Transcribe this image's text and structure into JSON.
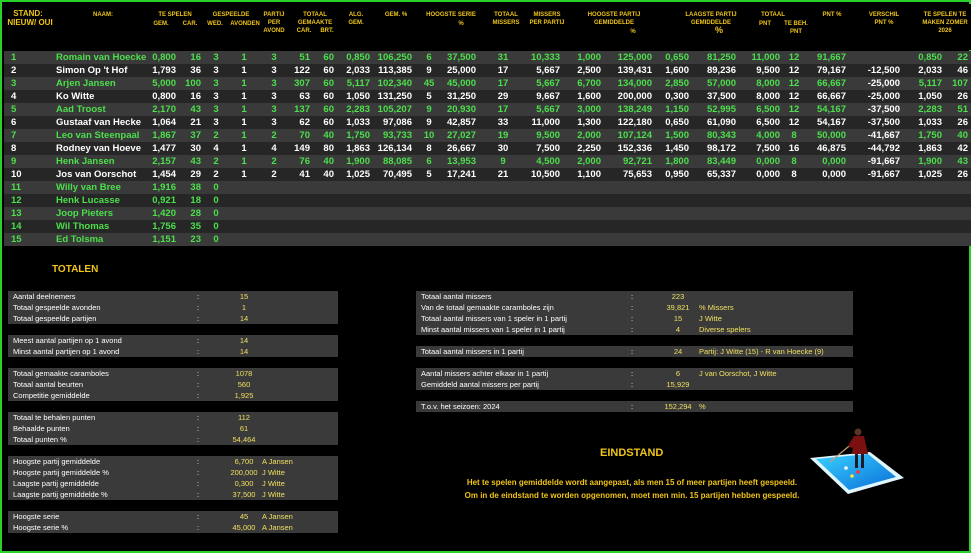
{
  "header": {
    "stand": "STAND:",
    "nieuw_oud": "NIEUW/ OUI",
    "naam": "NAAM:",
    "te_spelen": "TE SPELEN",
    "gem": "GEM.",
    "car": "CAR.",
    "gespeelde": "GESPEELDE",
    "wed": "WED.",
    "avonden": "AVONDEN",
    "partij_per_avond": "PARTIJ PER AVOND",
    "totaal_gemaakte": "TOTAAL GEMAAKTE",
    "car2": "CAR.",
    "brt": "BRT.",
    "alg_gem": "ALG. GEM.",
    "gem_pct": "GEM. %",
    "hoogste_serie": "HOOGSTE SERIE",
    "pct": "%",
    "totaal_missers": "TOTAAL MISSERS",
    "missers_per_partij": "MISSERS PER PARTIJ",
    "hoogste_partij_gem": "HOOGSTE PARTIJ GEMIDDELDE",
    "pct2": "%",
    "laagste_partij_gem": "LAAGSTE PARTIJ GEMIDDELDE",
    "pct3": "%",
    "totaal": "TOTAAL",
    "pnt": "PNT",
    "te_beh": "TE BEH. PNT",
    "pnt_pct": "PNT %",
    "verschil": "VERSCHIL PNT %",
    "te_spelen_zomer": "TE SPELEN TE MAKEN ZOMER 2026"
  },
  "players": [
    {
      "nr": "1",
      "naam": "Romain van Hoecke",
      "gem": "0,800",
      "car": "16",
      "wed": "3",
      "avo": "1",
      "ppa": "3",
      "tcar": "51",
      "brt": "60",
      "alg": "0,850",
      "gpct": "106,250",
      "hs": "6",
      "hspct": "37,500",
      "tm": "31",
      "mpp": "10,333",
      "hp": "1,000",
      "hppct": "125,000",
      "lp": "0,650",
      "lppct": "81,250",
      "tp": "11,000",
      "tb": "12",
      "pp": "91,667",
      "vp": "",
      "zg": "0,850",
      "zc": "22",
      "color": "#4cdf4c"
    },
    {
      "nr": "2",
      "naam": "Simon Op 't Hof",
      "gem": "1,793",
      "car": "36",
      "wed": "3",
      "avo": "1",
      "ppa": "3",
      "tcar": "122",
      "brt": "60",
      "alg": "2,033",
      "gpct": "113,385",
      "hs": "9",
      "hspct": "25,000",
      "tm": "17",
      "mpp": "5,667",
      "hp": "2,500",
      "hppct": "139,431",
      "lp": "1,600",
      "lppct": "89,236",
      "tp": "9,500",
      "tb": "12",
      "pp": "79,167",
      "vp": "-12,500",
      "zg": "2,033",
      "zc": "46",
      "color": "#ffffff"
    },
    {
      "nr": "3",
      "naam": "Arjen Jansen",
      "gem": "5,000",
      "car": "100",
      "wed": "3",
      "avo": "1",
      "ppa": "3",
      "tcar": "307",
      "brt": "60",
      "alg": "5,117",
      "gpct": "102,340",
      "hs": "45",
      "hspct": "45,000",
      "tm": "17",
      "mpp": "5,667",
      "hp": "6,700",
      "hppct": "134,000",
      "lp": "2,850",
      "lppct": "57,000",
      "tp": "8,000",
      "tb": "12",
      "pp": "66,667",
      "vp": "-25,000",
      "zg": "5,117",
      "zc": "107",
      "color": "#4cdf4c"
    },
    {
      "nr": "4",
      "naam": "Ko Witte",
      "gem": "0,800",
      "car": "16",
      "wed": "3",
      "avo": "1",
      "ppa": "3",
      "tcar": "63",
      "brt": "60",
      "alg": "1,050",
      "gpct": "131,250",
      "hs": "5",
      "hspct": "31,250",
      "tm": "29",
      "mpp": "9,667",
      "hp": "1,600",
      "hppct": "200,000",
      "lp": "0,300",
      "lppct": "37,500",
      "tp": "8,000",
      "tb": "12",
      "pp": "66,667",
      "vp": "-25,000",
      "zg": "1,050",
      "zc": "26",
      "color": "#ffffff"
    },
    {
      "nr": "5",
      "naam": "Aad Troost",
      "gem": "2,170",
      "car": "43",
      "wed": "3",
      "avo": "1",
      "ppa": "3",
      "tcar": "137",
      "brt": "60",
      "alg": "2,283",
      "gpct": "105,207",
      "hs": "9",
      "hspct": "20,930",
      "tm": "17",
      "mpp": "5,667",
      "hp": "3,000",
      "hppct": "138,249",
      "lp": "1,150",
      "lppct": "52,995",
      "tp": "6,500",
      "tb": "12",
      "pp": "54,167",
      "vp": "-37,500",
      "zg": "2,283",
      "zc": "51",
      "color": "#4cdf4c"
    },
    {
      "nr": "6",
      "naam": "Gustaaf van Hecke",
      "gem": "1,064",
      "car": "21",
      "wed": "3",
      "avo": "1",
      "ppa": "3",
      "tcar": "62",
      "brt": "60",
      "alg": "1,033",
      "gpct": "97,086",
      "hs": "9",
      "hspct": "42,857",
      "tm": "33",
      "mpp": "11,000",
      "hp": "1,300",
      "hppct": "122,180",
      "lp": "0,650",
      "lppct": "61,090",
      "tp": "6,500",
      "tb": "12",
      "pp": "54,167",
      "vp": "-37,500",
      "zg": "1,033",
      "zc": "26",
      "color": "#ffffff"
    },
    {
      "nr": "7",
      "naam": "Leo van Steenpaal",
      "gem": "1,867",
      "car": "37",
      "wed": "2",
      "avo": "1",
      "ppa": "2",
      "tcar": "70",
      "brt": "40",
      "alg": "1,750",
      "gpct": "93,733",
      "hs": "10",
      "hspct": "27,027",
      "tm": "19",
      "mpp": "9,500",
      "hp": "2,000",
      "hppct": "107,124",
      "lp": "1,500",
      "lppct": "80,343",
      "tp": "4,000",
      "tb": "8",
      "pp": "50,000",
      "vp": "-41,667",
      "zg": "1,750",
      "zc": "40",
      "color": "#4cdf4c"
    },
    {
      "nr": "8",
      "naam": "Rodney van Hoeve",
      "gem": "1,477",
      "car": "30",
      "wed": "4",
      "avo": "1",
      "ppa": "4",
      "tcar": "149",
      "brt": "80",
      "alg": "1,863",
      "gpct": "126,134",
      "hs": "8",
      "hspct": "26,667",
      "tm": "30",
      "mpp": "7,500",
      "hp": "2,250",
      "hppct": "152,336",
      "lp": "1,450",
      "lppct": "98,172",
      "tp": "7,500",
      "tb": "16",
      "pp": "46,875",
      "vp": "-44,792",
      "zg": "1,863",
      "zc": "42",
      "color": "#ffffff"
    },
    {
      "nr": "9",
      "naam": "Henk Jansen",
      "gem": "2,157",
      "car": "43",
      "wed": "2",
      "avo": "1",
      "ppa": "2",
      "tcar": "76",
      "brt": "40",
      "alg": "1,900",
      "gpct": "88,085",
      "hs": "6",
      "hspct": "13,953",
      "tm": "9",
      "mpp": "4,500",
      "hp": "2,000",
      "hppct": "92,721",
      "lp": "1,800",
      "lppct": "83,449",
      "tp": "0,000",
      "tb": "8",
      "pp": "0,000",
      "vp": "-91,667",
      "zg": "1,900",
      "zc": "43",
      "color": "#4cdf4c"
    },
    {
      "nr": "10",
      "naam": "Jos van Oorschot",
      "gem": "1,454",
      "car": "29",
      "wed": "2",
      "avo": "1",
      "ppa": "2",
      "tcar": "41",
      "brt": "40",
      "alg": "1,025",
      "gpct": "70,495",
      "hs": "5",
      "hspct": "17,241",
      "tm": "21",
      "mpp": "10,500",
      "hp": "1,100",
      "hppct": "75,653",
      "lp": "0,950",
      "lppct": "65,337",
      "tp": "0,000",
      "tb": "8",
      "pp": "0,000",
      "vp": "-91,667",
      "zg": "1,025",
      "zc": "26",
      "color": "#ffffff"
    },
    {
      "nr": "11",
      "naam": "Willy van Bree",
      "gem": "1,916",
      "car": "38",
      "wed": "0",
      "color": "#4cdf4c"
    },
    {
      "nr": "12",
      "naam": "Henk Lucasse",
      "gem": "0,921",
      "car": "18",
      "wed": "0",
      "color": "#4cdf4c"
    },
    {
      "nr": "13",
      "naam": "Joop Pieters",
      "gem": "1,420",
      "car": "28",
      "wed": "0",
      "color": "#4cdf4c"
    },
    {
      "nr": "14",
      "naam": "Wil Thomas",
      "gem": "1,756",
      "car": "35",
      "wed": "0",
      "color": "#4cdf4c"
    },
    {
      "nr": "15",
      "naam": "Ed Tolsma",
      "gem": "1,151",
      "car": "23",
      "wed": "0",
      "color": "#4cdf4c"
    }
  ],
  "totalen_title": "TOTALEN",
  "left_stats": [
    {
      "label": "Aantal deelnemers",
      "value": "15",
      "note": ""
    },
    {
      "label": "Totaal gespeelde avonden",
      "value": "1",
      "note": ""
    },
    {
      "label": "Totaal gespeelde partijen",
      "value": "14",
      "note": ""
    },
    {
      "gap": true
    },
    {
      "label": "Meest aantal partijen op 1 avond",
      "value": "14",
      "note": ""
    },
    {
      "label": "Minst aantal partijen op 1 avond",
      "value": "14",
      "note": ""
    },
    {
      "gap": true
    },
    {
      "label": "Totaal gemaakte caramboles",
      "value": "1078",
      "note": ""
    },
    {
      "label": "Totaal aantal beurten",
      "value": "560",
      "note": ""
    },
    {
      "label": "Competitie gemiddelde",
      "value": "1,925",
      "note": ""
    },
    {
      "gap": true
    },
    {
      "label": "Totaal te behalen punten",
      "value": "112",
      "note": ""
    },
    {
      "label": "Behaalde punten",
      "value": "61",
      "note": ""
    },
    {
      "label": "Totaal punten %",
      "value": "54,464",
      "note": ""
    },
    {
      "gap": true
    },
    {
      "label": "Hoogste partij gemiddelde",
      "value": "6,700",
      "note": "A Jansen"
    },
    {
      "label": "Hoogste partij gemiddelde %",
      "value": "200,000",
      "note": "J Witte"
    },
    {
      "label": "Laagste partij gemiddelde",
      "value": "0,300",
      "note": "J Witte"
    },
    {
      "label": "Laagste partij gemiddelde %",
      "value": "37,500",
      "note": "J Witte"
    },
    {
      "gap": true
    },
    {
      "label": "Hoogste serie",
      "value": "45",
      "note": "A Jansen"
    },
    {
      "label": "Hoogste serie %",
      "value": "45,000",
      "note": "A Jansen"
    }
  ],
  "right_stats": [
    {
      "label": "Totaal aantal missers",
      "value": "223",
      "note": ""
    },
    {
      "label": "Van de totaal gemaakte caramboles zijn",
      "value": "39,821",
      "note": "% Missers"
    },
    {
      "label": "Totaal aantal missers van 1 speler in 1 partij",
      "value": "15",
      "note": "J Witte"
    },
    {
      "label": "Minst aantal missers van 1 speler in 1 partij",
      "value": "4",
      "note": "Diverse spelers"
    },
    {
      "gap": true
    },
    {
      "label": "Totaal aantal missers in 1 partij",
      "value": "24",
      "note": "Partij: J Witte (15) - R van Hoecke (9)"
    },
    {
      "gap": true
    },
    {
      "label": "Aantal missers achter elkaar in 1 partij",
      "value": "6",
      "note": "J van Oorschot, J Witte"
    },
    {
      "label": "Gemiddeld aantal missers per partij",
      "value": "15,929",
      "note": ""
    },
    {
      "gap": true
    },
    {
      "label": "T.o.v. het seizoen: 2024",
      "value": "152,294",
      "note": "%"
    }
  ],
  "eindstand_title": "EINDSTAND",
  "message_line1": "Het te spelen gemiddelde wordt aangepast, als men 15 of meer partijen heeft gespeeld.",
  "message_line2": "Om in de eindstand te worden opgenomen, moet men min. 15 partijen hebben gespeeld.",
  "colors": {
    "border": "#2bd12b",
    "header": "#f0c419",
    "green": "#4cdf4c",
    "value": "#f0e060"
  }
}
